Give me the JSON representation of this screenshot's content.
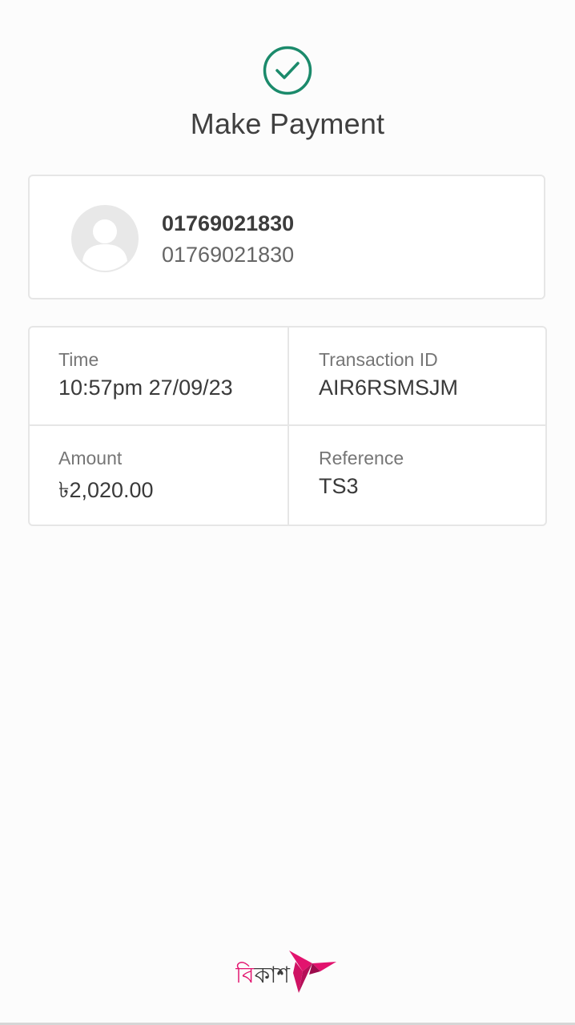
{
  "header": {
    "title": "Make Payment",
    "success_icon": "check-circle-icon",
    "success_color": "#1b8a6b"
  },
  "recipient": {
    "name": "01769021830",
    "number": "01769021830",
    "avatar_icon": "person-icon"
  },
  "details": {
    "time_label": "Time",
    "time_value": "10:57pm 27/09/23",
    "transaction_label": "Transaction ID",
    "transaction_value": "AIR6RSMSJM",
    "amount_label": "Amount",
    "amount_value": "৳2,020.00",
    "reference_label": "Reference",
    "reference_value": "TS3"
  },
  "brand": {
    "logo_text": "বিকাশ",
    "logo_icon": "origami-bird-icon",
    "brand_color": "#e2136e"
  }
}
